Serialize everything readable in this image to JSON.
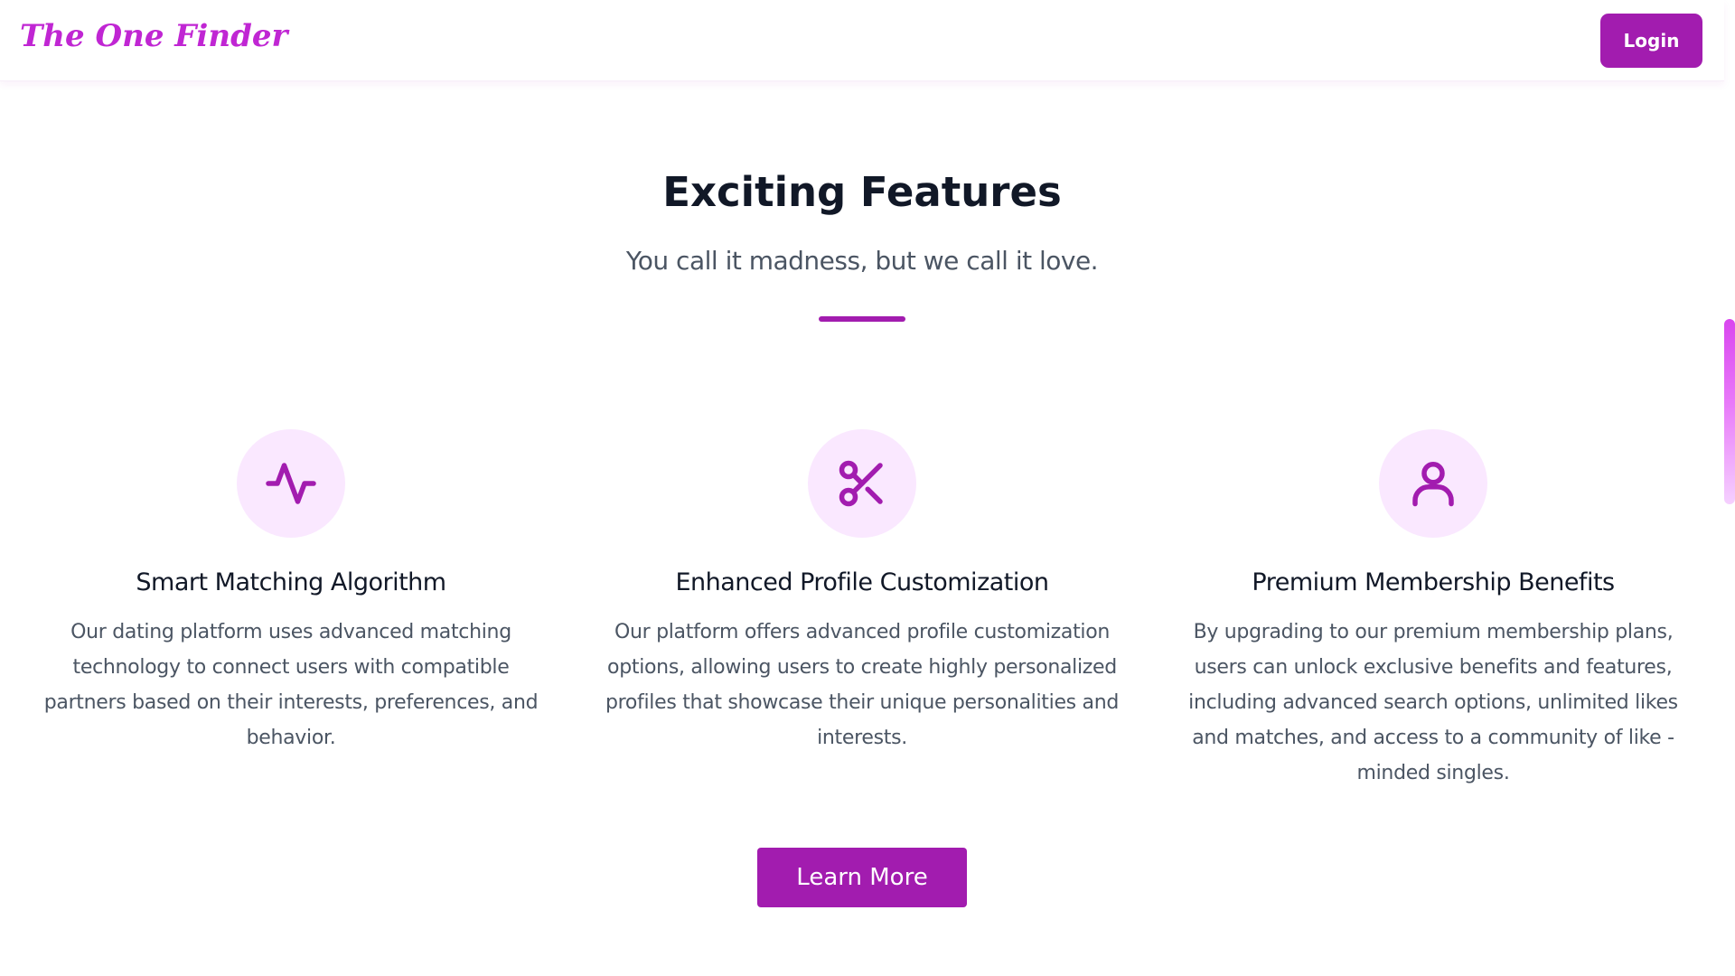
{
  "header": {
    "logo_text": "The One Finder",
    "login_label": "Login",
    "reading_progress": 0.16
  },
  "section": {
    "title": "Exciting Features",
    "subtitle": "You call it madness, but we call it love."
  },
  "features": [
    {
      "icon": "activity-icon",
      "title": "Smart Matching Algorithm",
      "description": "Our dating platform uses advanced matching technology to connect users with compatible partners based on their interests, preferences, and behavior."
    },
    {
      "icon": "scissors-icon",
      "title": "Enhanced Profile Customization",
      "description": "Our platform offers advanced profile customization options, allowing users to create highly personalized profiles that showcase their unique personalities and interests."
    },
    {
      "icon": "user-icon",
      "title": "Premium Membership Benefits",
      "description": "By upgrading to our premium membership plans, users can unlock exclusive benefits and features, including advanced search options, unlimited likes and matches, and access to a community of like - minded singles."
    }
  ],
  "cta": {
    "learn_more_label": "Learn More"
  },
  "colors": {
    "brand": "#a21caf",
    "logo": "#c026d3",
    "icon_bg": "#fae8ff",
    "progress": "#1e88e5"
  }
}
